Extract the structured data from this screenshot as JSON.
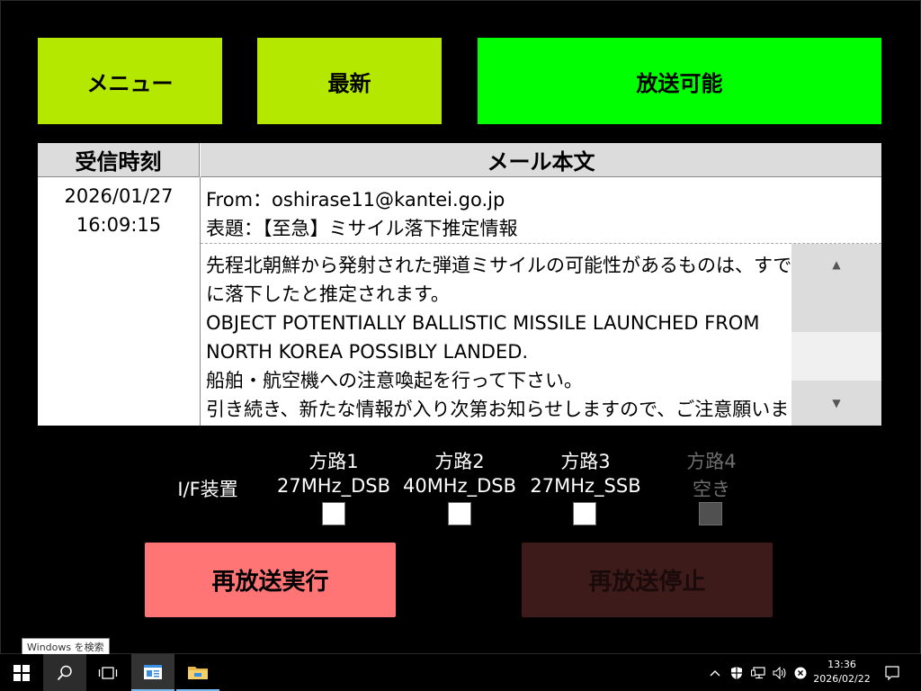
{
  "header": {
    "menu_label": "メニュー",
    "latest_label": "最新",
    "status_label": "放送可能"
  },
  "colors": {
    "menu_button": "#b4e800",
    "status_ok": "#00ff00",
    "resend_button": "#ff7474",
    "stop_button": "#3e1b1b"
  },
  "mail_table": {
    "col_time": "受信時刻",
    "col_body": "メール本文",
    "received_date": "2026/01/27",
    "received_time": "16:09:15",
    "from": "From：oshirase11@kantei.go.jp",
    "subject": "表題：【至急】ミサイル落下推定情報",
    "body_lines": [
      "先程北朝鮮から発射された弾道ミサイルの可能性があるものは、すで",
      "に落下したと推定されます。",
      "OBJECT POTENTIALLY BALLISTIC MISSILE LAUNCHED FROM",
      "NORTH KOREA POSSIBLY LANDED.",
      "船舶・航空機への注意喚起を行って下さい。",
      "引き続き、新たな情報が入り次第お知らせしますので、ご注意願いま"
    ]
  },
  "devices": {
    "if_label": "I/F装置",
    "routes": [
      {
        "name": "方路1",
        "mode": "27MHz_DSB",
        "checked": false,
        "enabled": true
      },
      {
        "name": "方路2",
        "mode": "40MHz_DSB",
        "checked": false,
        "enabled": true
      },
      {
        "name": "方路3",
        "mode": "27MHz_SSB",
        "checked": false,
        "enabled": true
      },
      {
        "name": "方路4",
        "mode": "空き",
        "checked": false,
        "enabled": false
      }
    ]
  },
  "actions": {
    "resend_label": "再放送実行",
    "stop_label": "再放送停止"
  },
  "taskbar": {
    "search_tooltip": "Windows を検索",
    "time": "13:36",
    "date": "2026/02/22"
  }
}
